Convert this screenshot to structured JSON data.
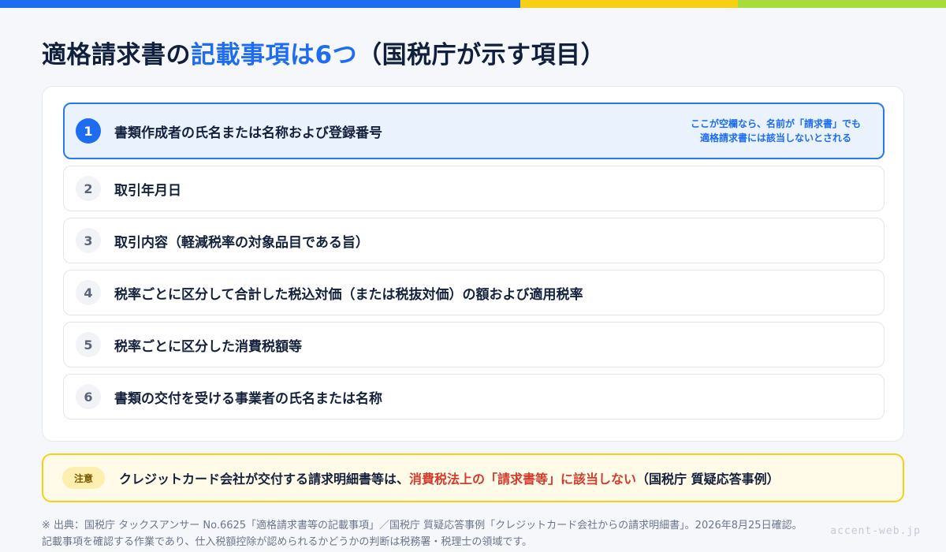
{
  "colors": {
    "accent_blue": "#1e6cf0",
    "accent_yellow": "#f7cf13",
    "accent_green": "#a6dd3c",
    "warning_red": "#d23b2d"
  },
  "title": {
    "part1": "適格請求書の",
    "highlight": "記載事項は6つ",
    "part2": "（国税庁が示す項目）"
  },
  "items": [
    {
      "num": "1",
      "text": "書類作成者の氏名または名称および登録番号",
      "note_line1": "ここが空欄なら、名前が「請求書」でも",
      "note_line2": "適格請求書には該当しないとされる"
    },
    {
      "num": "2",
      "text": "取引年月日"
    },
    {
      "num": "3",
      "text": "取引内容（軽減税率の対象品目である旨）"
    },
    {
      "num": "4",
      "text": "税率ごとに区分して合計した税込対価（または税抜対価）の額および適用税率"
    },
    {
      "num": "5",
      "text": "税率ごとに区分した消費税額等"
    },
    {
      "num": "6",
      "text": "書類の交付を受ける事業者の氏名または名称"
    }
  ],
  "caution": {
    "badge": "注意",
    "text_before": "クレジットカード会社が交付する請求明細書等は、",
    "text_red": "消費税法上の「請求書等」に該当しない",
    "text_after": "（国税庁 質疑応答事例）"
  },
  "footer": {
    "line1": "※ 出典：国税庁 タックスアンサー No.6625「適格請求書等の記載事項」／国税庁 質疑応答事例「クレジットカード会社からの請求明細書」。2026年8月25日確認。",
    "line2": "記載事項を確認する作業であり、仕入税額控除が認められるかどうかの判断は税務署・税理士の領域です。"
  },
  "watermark": "accent-web.jp"
}
